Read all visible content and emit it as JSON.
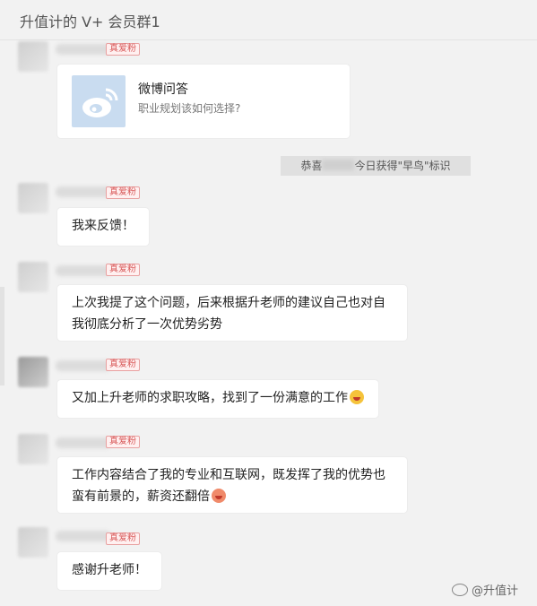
{
  "header": {
    "title": "升值计的 V+ 会员群1"
  },
  "tag_label": "真爱粉",
  "card": {
    "title": "微博问答",
    "subtitle": "职业规划该如何选择?"
  },
  "notice": {
    "prefix": "恭喜",
    "suffix": "今日获得\"早鸟\"标识"
  },
  "messages": [
    {
      "text": "我来反馈！"
    },
    {
      "text": "上次我提了这个问题，后来根据升老师的建议自己也对自我彻底分析了一次优势劣势"
    },
    {
      "text": "又加上升老师的求职攻略，找到了一份满意的工作"
    },
    {
      "text": "工作内容结合了我的专业和互联网，既发挥了我的优势也蛮有前景的，薪资还翻倍"
    },
    {
      "text": "感谢升老师！"
    }
  ],
  "watermark": "@升值计",
  "icons": {
    "weibo": "weibo-logo-icon",
    "laugh": "laughing-emoji-icon",
    "money": "money-emoji-icon",
    "weibo_watermark": "weibo-watermark-icon"
  },
  "colors": {
    "tag_text": "#d85a5a",
    "bubble_bg": "#ffffff",
    "page_bg": "#f2f2f2"
  }
}
